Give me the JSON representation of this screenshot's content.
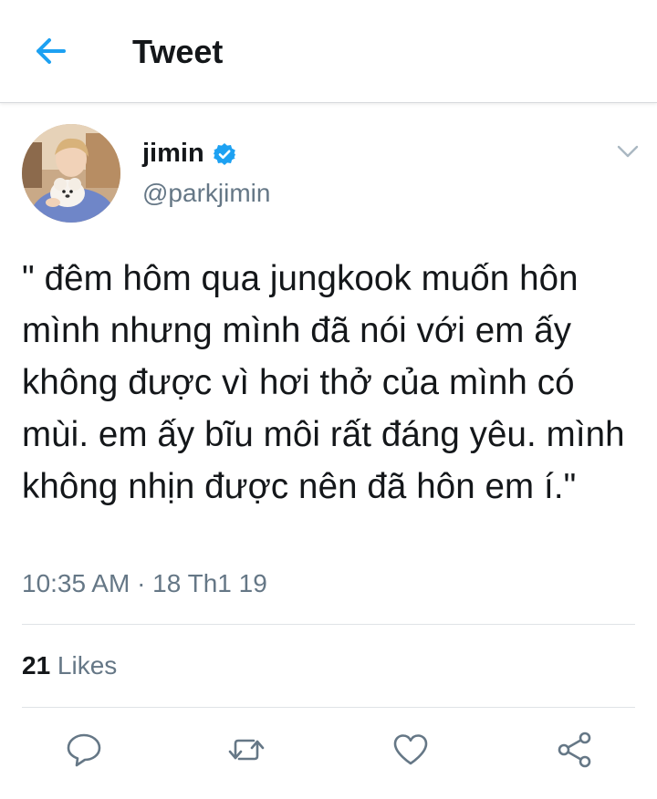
{
  "header": {
    "title": "Tweet",
    "back_icon": "arrow-left-icon",
    "accent_color": "#1da1f2"
  },
  "tweet": {
    "author": {
      "display_name": "jimin",
      "handle": "@parkjimin",
      "verified": true
    },
    "text": "\" đêm hôm qua jungkook muốn hôn mình nhưng mình đã nói với em ấy không được vì hơi thở của mình có mùi. em ấy bĩu môi rất đáng yêu. mình không nhịn được nên đã hôn em í.\"",
    "timestamp": "10:35 AM · 18 Th1 19",
    "likes": {
      "count": "21",
      "label": " Likes"
    }
  },
  "actions": [
    {
      "name": "reply",
      "icon": "reply-icon"
    },
    {
      "name": "retweet",
      "icon": "retweet-icon"
    },
    {
      "name": "like",
      "icon": "heart-icon"
    },
    {
      "name": "share",
      "icon": "share-icon"
    }
  ]
}
